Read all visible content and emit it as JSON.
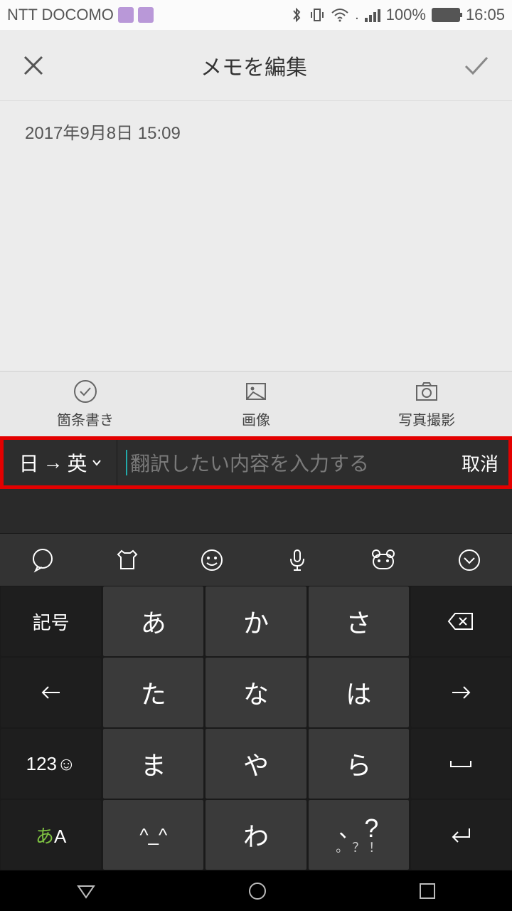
{
  "status": {
    "carrier": "NTT DOCOMO",
    "battery_pct": "100%",
    "time": "16:05"
  },
  "header": {
    "title": "メモを編集"
  },
  "memo": {
    "timestamp": "2017年9月8日 15:09"
  },
  "toolbar": {
    "items": [
      {
        "label": "箇条書き"
      },
      {
        "label": "画像"
      },
      {
        "label": "写真撮影"
      }
    ]
  },
  "translate": {
    "lang_from": "日",
    "lang_to": "英",
    "placeholder": "翻訳したい内容を入力する",
    "cancel": "取消"
  },
  "keyboard": {
    "rows": [
      [
        "記号",
        "あ",
        "か",
        "さ",
        "⌫"
      ],
      [
        "←",
        "た",
        "な",
        "は",
        "→"
      ],
      [
        "123☺",
        "ま",
        "や",
        "ら",
        "␣"
      ],
      [
        "あA",
        "^_^",
        "わ",
        "?!",
        "↵"
      ]
    ],
    "punct_sub": "。 ？ ！"
  }
}
